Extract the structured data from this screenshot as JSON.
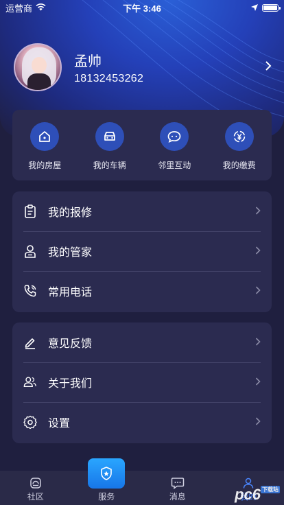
{
  "status_bar": {
    "carrier": "运营商",
    "time": "下午 3:46"
  },
  "profile": {
    "name": "孟帅",
    "phone": "18132453262"
  },
  "quick_actions": [
    {
      "label": "我的房屋",
      "icon": "house-icon"
    },
    {
      "label": "我的车辆",
      "icon": "car-icon"
    },
    {
      "label": "邻里互动",
      "icon": "chat-icon"
    },
    {
      "label": "我的缴费",
      "icon": "payment-icon"
    }
  ],
  "menu_group_1": [
    {
      "label": "我的报修",
      "icon": "clipboard-icon"
    },
    {
      "label": "我的管家",
      "icon": "butler-icon"
    },
    {
      "label": "常用电话",
      "icon": "phone-icon"
    }
  ],
  "menu_group_2": [
    {
      "label": "意见反馈",
      "icon": "feedback-icon"
    },
    {
      "label": "关于我们",
      "icon": "about-icon"
    },
    {
      "label": "设置",
      "icon": "settings-icon"
    }
  ],
  "tab_bar": [
    {
      "label": "社区",
      "icon": "community-icon"
    },
    {
      "label": "服务",
      "icon": "service-icon"
    },
    {
      "label": "消息",
      "icon": "message-icon"
    },
    {
      "label": "我的",
      "icon": "me-icon"
    }
  ],
  "watermark": {
    "text": "pc6",
    "sub": "下载站"
  },
  "colors": {
    "background": "#1f1f3f",
    "card": "#2b2b50",
    "accent": "#2e4fb8",
    "active_tab": "#4a86ff"
  }
}
